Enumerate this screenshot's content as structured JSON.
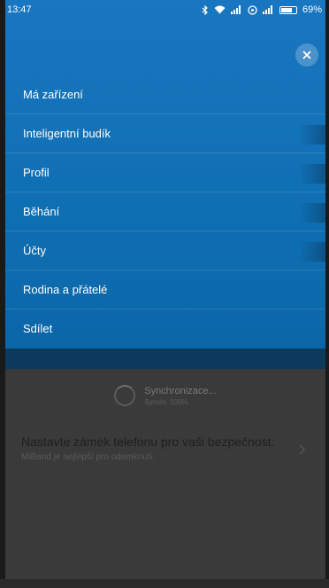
{
  "statusbar": {
    "time": "13:47",
    "battery": "69%",
    "icons": [
      "bluetooth-icon",
      "wifi-icon",
      "signal-icon",
      "alarm-icon",
      "signal-icon",
      "battery-icon"
    ]
  },
  "menu": {
    "close_icon": "close-icon",
    "items": [
      {
        "label": "Má zařízení"
      },
      {
        "label": "Inteligentní budík"
      },
      {
        "label": "Profil"
      },
      {
        "label": "Běhání"
      },
      {
        "label": "Účty"
      },
      {
        "label": "Rodina a přátelé"
      },
      {
        "label": "Sdílet"
      }
    ]
  },
  "sync": {
    "title": "Synchronizace...",
    "subtitle": "Synchr. 100%"
  },
  "notice": {
    "title": "Nastavte zámek telefonu pro vaši bezpečnost.",
    "subtitle": "MiBand je nejlepší pro odemknutí.",
    "chevron_icon": "chevron-right-icon"
  },
  "colors": {
    "menu_bg": "#0f6fb3",
    "menu_bottom": "#0c3a5c",
    "dim_bg": "#3a3a3a"
  }
}
